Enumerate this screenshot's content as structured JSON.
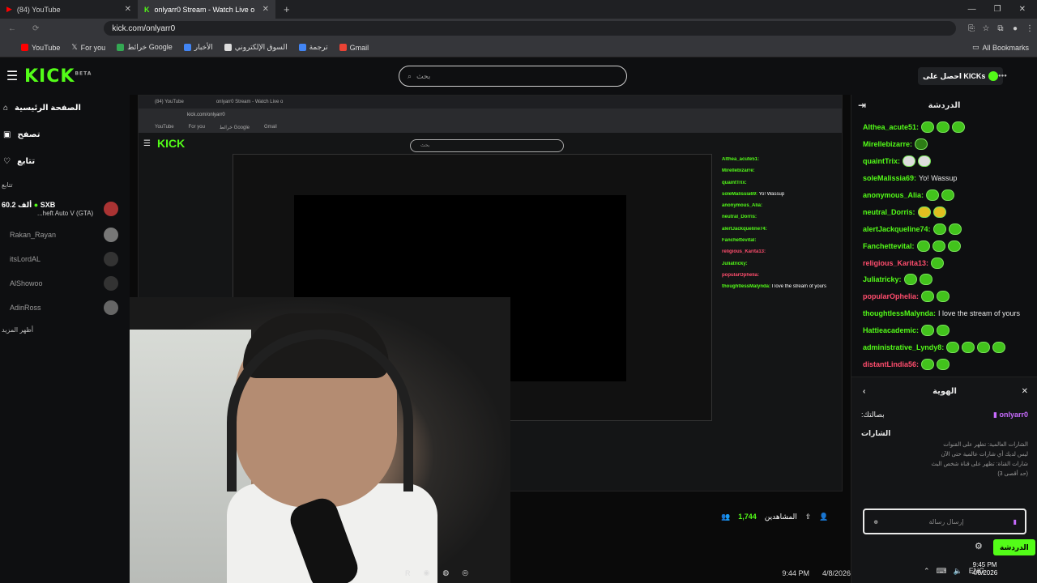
{
  "browser": {
    "tabs": [
      {
        "title": "(84) YouTube",
        "active": false
      },
      {
        "title": "onlyarr0 Stream - Watch Live o",
        "active": true
      }
    ],
    "new_tab": "+",
    "url": "kick.com/onlyarr0",
    "bookmarks": [
      "YouTube",
      "For you",
      "خرائط Google",
      "الأخبار",
      "السوق الإلكتروني",
      "ترجمة",
      "Gmail"
    ],
    "all_bookmarks": "All Bookmarks"
  },
  "kick": {
    "logo": "KICK",
    "beta": "BETA",
    "search_placeholder": "بحث",
    "get_kicks": "احصل على KICKs"
  },
  "sidebar": {
    "items": [
      {
        "label": "الصفحة الرئيسية",
        "icon": "home-icon"
      },
      {
        "label": "تصفح",
        "icon": "browse-icon"
      },
      {
        "label": "تتابع",
        "icon": "heart-icon"
      }
    ],
    "section": "تتابع",
    "channels": [
      {
        "name": "SXB",
        "viewers": "60.2 ألف",
        "game": "...heft Auto V (GTA)",
        "live": true
      },
      {
        "name": "Rakan_Rayan",
        "live": false
      },
      {
        "name": "itsLordAL",
        "live": false
      },
      {
        "name": "AlShowoo",
        "live": false
      },
      {
        "name": "AdinRoss",
        "live": false
      }
    ],
    "more": "أظهر المزيد"
  },
  "stream": {
    "viewers_label": "المشاهدين",
    "viewers": "1,744",
    "taskbar_clock": "9:44 PM",
    "taskbar_date": "4/8/2026"
  },
  "chat": {
    "title": "الدردشة",
    "messages": [
      {
        "user": "Althea_acute51:",
        "color": "#53fc18",
        "text": "",
        "emotes": 3
      },
      {
        "user": "Mirellebizarre:",
        "color": "#53fc18",
        "text": "",
        "emotes": 1
      },
      {
        "user": "quaintTrix:",
        "color": "#53fc18",
        "text": "",
        "emotes": 2
      },
      {
        "user": "soleMalissia69:",
        "color": "#53fc18",
        "text": "Yo! Wassup",
        "emotes": 0
      },
      {
        "user": "anonymous_Alia:",
        "color": "#53fc18",
        "text": "",
        "emotes": 2
      },
      {
        "user": "neutral_Dorris:",
        "color": "#53fc18",
        "text": "",
        "emotes": 2
      },
      {
        "user": "alertJackqueline74:",
        "color": "#53fc18",
        "text": "",
        "emotes": 2
      },
      {
        "user": "Fanchettevital:",
        "color": "#53fc18",
        "text": "",
        "emotes": 3
      },
      {
        "user": "religious_Karita13:",
        "color": "#ff4d6d",
        "text": "",
        "emotes": 1
      },
      {
        "user": "Juliatricky:",
        "color": "#53fc18",
        "text": "",
        "emotes": 2
      },
      {
        "user": "popularOphelia:",
        "color": "#ff4d6d",
        "text": "",
        "emotes": 2
      },
      {
        "user": "thoughtlessMalynda:",
        "color": "#53fc18",
        "text": "I love the stream of yours",
        "emotes": 0
      },
      {
        "user": "Hattieacademic:",
        "color": "#53fc18",
        "text": "",
        "emotes": 2
      },
      {
        "user": "administrative_Lyndy8:",
        "color": "#53fc18",
        "text": "",
        "emotes": 4
      },
      {
        "user": "distantLindia56:",
        "color": "#ff4d6d",
        "text": "",
        "emotes": 2
      }
    ],
    "gift": {
      "title": "الهوية",
      "channel": "onlyarr0",
      "channel_label": ":بصالتك",
      "badges_title": "الشارات",
      "badges_sub": "الشارات العالمية: تظهر على القنوات",
      "badges_none": "ليس لديك أي شارات عالمية حتى الآن",
      "channel_badges": "شارات القناة: تظهر على قناة شخص البث",
      "channel_badges_sub": "(حد أقصى 3)"
    },
    "input_placeholder": "إرسال رسالة",
    "send": "الدردشة"
  },
  "os": {
    "lang": "ENG",
    "time": "9:45 PM",
    "date": "4/8/2026"
  }
}
